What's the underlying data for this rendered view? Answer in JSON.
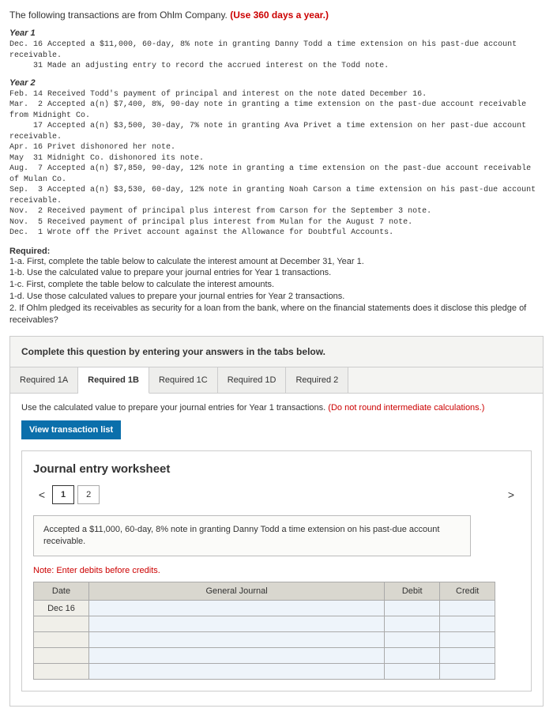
{
  "intro": {
    "lead": "The following transactions are from Ohlm Company.",
    "red": "(Use 360 days a year.)"
  },
  "year1_head": "Year 1",
  "year1_txns": "Dec. 16 Accepted a $11,000, 60-day, 8% note in granting Danny Todd a time extension on his past-due account receivable.\n     31 Made an adjusting entry to record the accrued interest on the Todd note.",
  "year2_head": "Year 2",
  "year2_txns": "Feb. 14 Received Todd's payment of principal and interest on the note dated December 16.\nMar.  2 Accepted a(n) $7,400, 8%, 90-day note in granting a time extension on the past-due account receivable from Midnight Co.\n     17 Accepted a(n) $3,500, 30-day, 7% note in granting Ava Privet a time extension on her past-due account receivable.\nApr. 16 Privet dishonored her note.\nMay  31 Midnight Co. dishonored its note.\nAug.  7 Accepted a(n) $7,850, 90-day, 12% note in granting a time extension on the past-due account receivable of Mulan Co.\nSep.  3 Accepted a(n) $3,530, 60-day, 12% note in granting Noah Carson a time extension on his past-due account receivable.\nNov.  2 Received payment of principal plus interest from Carson for the September 3 note.\nNov.  5 Received payment of principal plus interest from Mulan for the August 7 note.\nDec.  1 Wrote off the Privet account against the Allowance for Doubtful Accounts.",
  "required_head": "Required:",
  "required": {
    "a": "1-a. First, complete the table below to calculate the interest amount at December 31, Year 1.",
    "b": "1-b. Use the calculated value to prepare your journal entries for Year 1 transactions.",
    "c": "1-c. First, complete the table below to calculate the interest amounts.",
    "d": "1-d. Use those calculated values to prepare your journal entries for Year 2 transactions.",
    "e": "2. If Ohlm pledged its receivables as security for a loan from the bank, where on the financial statements does it disclose this pledge of receivables?"
  },
  "panel_head": "Complete this question by entering your answers in the tabs below.",
  "tabs": {
    "t1": "Required 1A",
    "t2": "Required 1B",
    "t3": "Required 1C",
    "t4": "Required 1D",
    "t5": "Required 2"
  },
  "hint": {
    "black": "Use the calculated value to prepare your journal entries for Year 1 transactions. ",
    "red": "(Do not round intermediate calculations.)"
  },
  "view_btn": "View transaction list",
  "ws_title": "Journal entry worksheet",
  "pager": {
    "p1": "1",
    "p2": "2",
    "left": "<",
    "right": ">"
  },
  "entry_desc": "Accepted a $11,000, 60-day, 8% note in granting Danny Todd a time extension on his past-due account receivable.",
  "note_red": "Note: Enter debits before credits.",
  "je_headers": {
    "date": "Date",
    "gj": "General Journal",
    "debit": "Debit",
    "credit": "Credit"
  },
  "je_rows": [
    {
      "date": "Dec 16"
    }
  ]
}
